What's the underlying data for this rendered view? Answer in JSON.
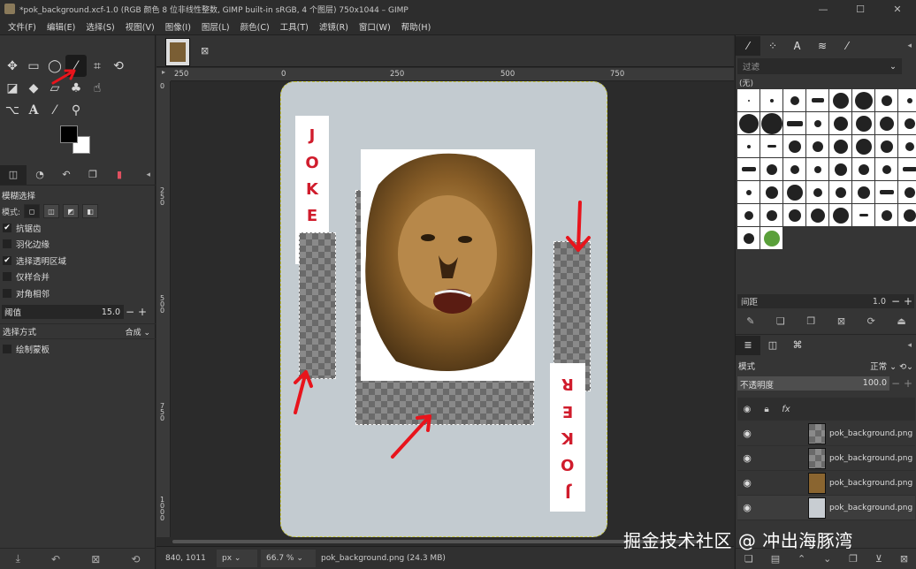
{
  "window": {
    "title": "*pok_background.xcf-1.0 (RGB 颜色 8 位非线性整数, GIMP built-in sRGB, 4 个图层) 750x1044 – GIMP",
    "minimize": "—",
    "maximize": "☐",
    "close": "✕"
  },
  "menu": [
    "文件(F)",
    "编辑(E)",
    "选择(S)",
    "视图(V)",
    "图像(I)",
    "图层(L)",
    "颜色(C)",
    "工具(T)",
    "滤镜(R)",
    "窗口(W)",
    "帮助(H)"
  ],
  "toolbox": {
    "tools": [
      "move-icon",
      "rect-select-icon",
      "lasso-icon",
      "fuzzy-select-icon",
      "crop-icon",
      "transform-icon",
      "warp-icon",
      "bucket-fill-icon",
      "paint-icon",
      "eraser-icon",
      "clone-icon",
      "smudge-icon",
      "paths-icon",
      "text-icon",
      "color-picker-icon",
      "zoom-icon"
    ],
    "active_tool": "fuzzy-select-icon",
    "fg_color": "#000000",
    "bg_color": "#ffffff"
  },
  "tool_options": {
    "title": "模糊选择",
    "mode_label": "模式:",
    "antialias": {
      "label": "抗锯齿",
      "checked": true
    },
    "feather": {
      "label": "羽化边缘",
      "checked": false
    },
    "select_transparent": {
      "label": "选择透明区域",
      "checked": true
    },
    "sample_merged": {
      "label": "仅样合并",
      "checked": false
    },
    "diagonal": {
      "label": "对角相邻",
      "checked": false
    },
    "threshold": {
      "label": "阈值",
      "value": "15.0"
    },
    "select_by": {
      "label": "选择方式",
      "value": "合成"
    },
    "draw_mask": {
      "label": "绘制蒙板",
      "checked": false
    }
  },
  "canvas": {
    "ruler_ticks": [
      "250",
      "0",
      "250",
      "500",
      "750"
    ],
    "vruler_ticks": [
      "0",
      "250",
      "500",
      "750",
      "1000"
    ],
    "joker_left": [
      "J",
      "O",
      "K",
      "E",
      "R"
    ],
    "joker_right": [
      "J",
      "O",
      "K",
      "E",
      "R"
    ]
  },
  "statusbar": {
    "coords": "840, 1011",
    "unit": "px",
    "zoom": "66.7 %",
    "info": "pok_background.png (24.3 MB)"
  },
  "brushes": {
    "filter_placeholder": "过滤",
    "brush_name": "(无)",
    "spacing_label": "间距",
    "spacing_value": "1.0"
  },
  "layers_panel": {
    "mode_label": "模式",
    "mode_value": "正常",
    "opacity_label": "不透明度",
    "opacity_value": "100.0",
    "layers": [
      {
        "name": "pok_background.png",
        "thumb": "checker"
      },
      {
        "name": "pok_background.png",
        "thumb": "checker"
      },
      {
        "name": "pok_background.png",
        "thumb": "lion"
      },
      {
        "name": "pok_background.png",
        "thumb": "bg"
      }
    ]
  },
  "watermark": "掘金技术社区 @ 冲出海豚湾"
}
